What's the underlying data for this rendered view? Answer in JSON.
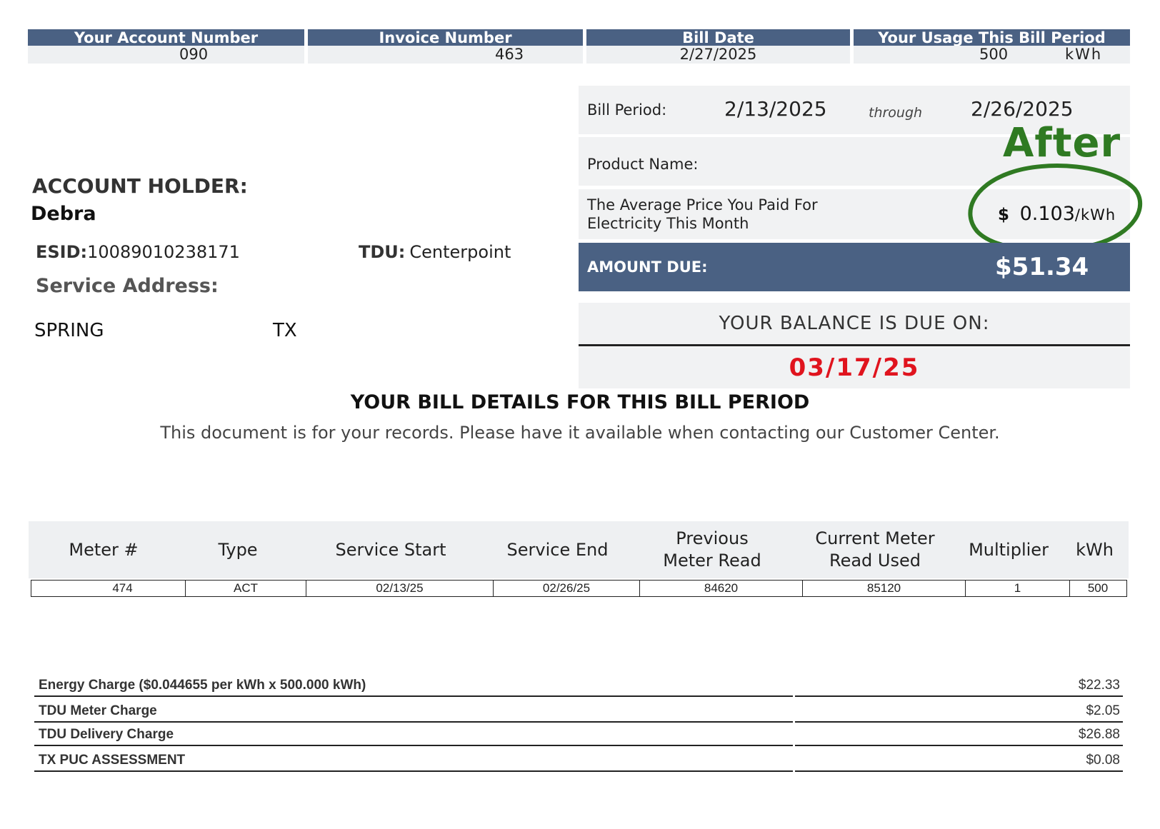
{
  "header": {
    "account_label": "Your Account Number",
    "account_value": "090",
    "invoice_label": "Invoice Number",
    "invoice_value": "463",
    "bill_date_label": "Bill Date",
    "bill_date_value": "2/27/2025",
    "usage_label": "Your Usage This Bill Period",
    "usage_value": "500",
    "usage_unit": "kWh"
  },
  "customer": {
    "holder_label": "ACCOUNT HOLDER:",
    "holder_name": "Debra",
    "esid_label": "ESID:",
    "esid_value": "10089010238171",
    "tdu_label": "TDU:",
    "tdu_value": "Centerpoint",
    "service_address_label": "Service Address:",
    "city": "SPRING",
    "state": "TX"
  },
  "summary": {
    "bill_period_label": "Bill Period:",
    "period_start": "2/13/2025",
    "through_label": "through",
    "period_end": "2/26/2025",
    "product_name_label": "Product Name:",
    "annotation_after": "After",
    "avg_price_line1": "The Average Price You Paid For",
    "avg_price_line2": "Electricity This Month",
    "avg_price_currency": "$",
    "avg_price_value": "0.103",
    "avg_price_unit": "/kWh",
    "amount_due_label": "AMOUNT DUE:",
    "amount_due_value": "$51.34",
    "due_label": "YOUR BALANCE IS DUE ON:",
    "due_date": "03/17/25",
    "annotation_color": "#2f7a22",
    "due_date_color": "#e0141e",
    "header_color": "#4a6183"
  },
  "details": {
    "title": "YOUR BILL DETAILS FOR THIS BILL PERIOD",
    "subtitle": "This document is for your records. Please have it available when contacting our Customer Center."
  },
  "meter_table": {
    "headers": [
      "Meter #",
      "Type",
      "Service Start",
      "Service End",
      "Previous\nMeter Read",
      "Current Meter\nRead Used",
      "Multiplier",
      "kWh"
    ],
    "rows": [
      [
        "474",
        "ACT",
        "02/13/25",
        "02/26/25",
        "84620",
        "85120",
        "1",
        "500"
      ]
    ]
  },
  "charges": [
    {
      "label": "Energy Charge ($0.044655 per kWh x 500.000 kWh)",
      "amount": "$22.33"
    },
    {
      "label": "TDU Meter Charge",
      "amount": "$2.05"
    },
    {
      "label": "TDU Delivery Charge",
      "amount": "$26.88"
    },
    {
      "label": "TX PUC ASSESSMENT",
      "amount": "$0.08"
    }
  ]
}
